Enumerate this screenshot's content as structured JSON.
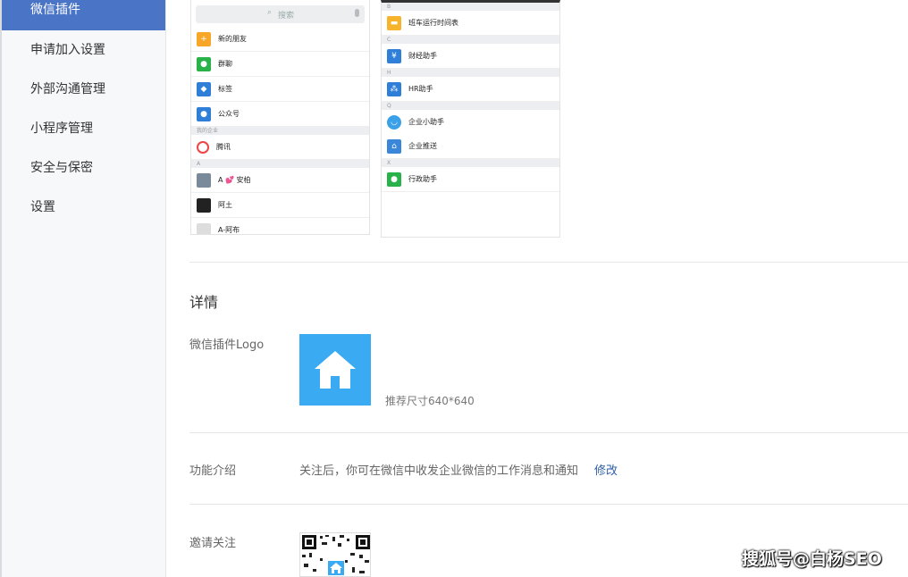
{
  "sidebar": {
    "items": [
      {
        "label": "微信插件"
      },
      {
        "label": "申请加入设置"
      },
      {
        "label": "外部沟通管理"
      },
      {
        "label": "小程序管理"
      },
      {
        "label": "安全与保密"
      },
      {
        "label": "设置"
      }
    ]
  },
  "preview_left": {
    "search_placeholder": "搜索",
    "rows": [
      "新的朋友",
      "群聊",
      "标签",
      "公众号"
    ],
    "section1": "我的企业",
    "company": "腾讯",
    "section2": "A",
    "contacts": [
      "A 💕 安柏",
      "阿土",
      "A-阿布"
    ]
  },
  "preview_right": {
    "rows": [
      "班车运行时间表",
      "财经助手",
      "HR助手",
      "企业小助手",
      "企业推送",
      "行政助手"
    ],
    "sections": [
      "B",
      "C",
      "H",
      "Q",
      "",
      "X"
    ]
  },
  "details": {
    "heading": "详情",
    "logo_label": "微信插件Logo",
    "logo_hint": "推荐尺寸640*640",
    "intro_label": "功能介绍",
    "intro_text": "关注后，你可在微信中收发企业微信的工作消息和通知",
    "edit_link": "修改",
    "invite_label": "邀请关注"
  },
  "watermark": "搜狐号@白杨SEO",
  "colors": {
    "accent": "#4a74c6",
    "logo_bg": "#3aaaf3",
    "link": "#2f5ea8"
  }
}
